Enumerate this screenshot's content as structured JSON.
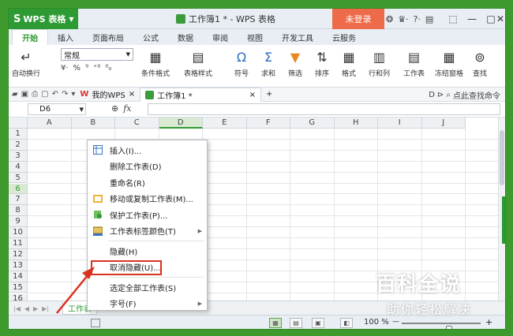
{
  "title_bar": {
    "app_name": "WPS 表格",
    "doc_title": "工作簿1 * - WPS 表格",
    "login_label": "未登录",
    "help_label": "?·",
    "minimize": "—",
    "maximize": "□",
    "close": "✕"
  },
  "ribbon_tabs": [
    "开始",
    "插入",
    "页面布局",
    "公式",
    "数据",
    "审阅",
    "视图",
    "开发工具",
    "云服务"
  ],
  "ribbon": {
    "wrap_text": "自动换行",
    "number_format": "常规",
    "percent": "%",
    "comma": "⁹",
    "cond_format": "条件格式",
    "table_style": "表格样式",
    "symbol": "符号",
    "sum": "求和",
    "filter": "筛选",
    "sort": "排序",
    "format": "格式",
    "rows_cols": "行和列",
    "worksheet": "工作表",
    "freeze": "冻结窗格",
    "find": "查找"
  },
  "doc_tabs": {
    "my_wps": "我的WPS",
    "workbook": "工作簿1 *",
    "add": "+",
    "search_cmd": "点此查找命令"
  },
  "formula_bar": {
    "cell_ref": "D6",
    "fx": "fx"
  },
  "grid": {
    "columns": [
      "A",
      "B",
      "C",
      "D",
      "E",
      "F",
      "G",
      "H",
      "I",
      "J"
    ],
    "rows": [
      "1",
      "2",
      "3",
      "4",
      "5",
      "6",
      "7",
      "8",
      "9",
      "10",
      "11",
      "12",
      "13",
      "14",
      "15",
      "16"
    ],
    "active_col": "D",
    "active_row": "6"
  },
  "context_menu": {
    "items": [
      {
        "label": "插入(I)...",
        "icon": "insert-sheet-icon",
        "submenu": false
      },
      {
        "label": "删除工作表(D)",
        "icon": "",
        "submenu": false
      },
      {
        "label": "重命名(R)",
        "icon": "",
        "submenu": false
      },
      {
        "label": "移动或复制工作表(M)...",
        "icon": "move-copy-icon",
        "submenu": false
      },
      {
        "label": "保护工作表(P)...",
        "icon": "protect-sheet-icon",
        "submenu": false
      },
      {
        "label": "工作表标签颜色(T)",
        "icon": "tab-color-icon",
        "submenu": true
      },
      {
        "label": "隐藏(H)",
        "icon": "",
        "submenu": false
      },
      {
        "label": "取消隐藏(U)...",
        "icon": "",
        "submenu": false
      },
      {
        "label": "选定全部工作表(S)",
        "icon": "",
        "submenu": false
      },
      {
        "label": "字号(F)",
        "icon": "",
        "submenu": true
      }
    ]
  },
  "sheet_bar": {
    "sheet_name": "工作表"
  },
  "status_bar": {
    "zoom": "100 %",
    "zoom_minus": "—",
    "zoom_plus": "+",
    "zoom_level": 0.6
  },
  "watermark": {
    "main": "百科全说",
    "sub": "助你轻松解决"
  },
  "colors": {
    "wps_green": "#2e9a34",
    "login_orange": "#ee6b4a",
    "highlight_red": "#d9321f"
  }
}
